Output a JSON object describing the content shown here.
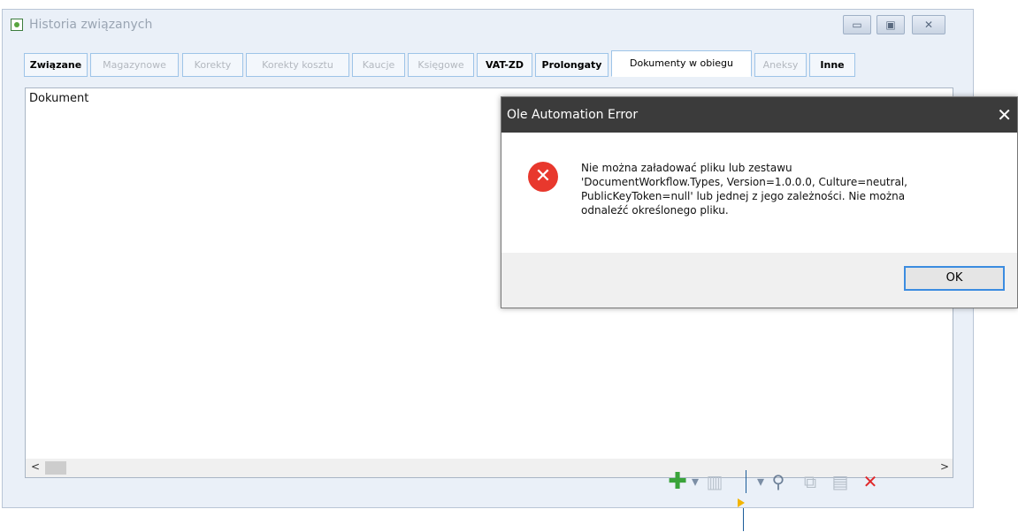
{
  "window": {
    "title": "Historia związanych",
    "controls": {
      "minimize": "▭",
      "maximize": "▣",
      "close": "✕"
    }
  },
  "tabs": [
    {
      "label": "Związane",
      "enabled": true
    },
    {
      "label": "Magazynowe",
      "enabled": false
    },
    {
      "label": "Korekty",
      "enabled": false
    },
    {
      "label": "Korekty kosztu",
      "enabled": false
    },
    {
      "label": "Kaucje",
      "enabled": false
    },
    {
      "label": "Księgowe",
      "enabled": false
    },
    {
      "label": "VAT-ZD",
      "enabled": true
    },
    {
      "label": "Prolongaty",
      "enabled": true
    },
    {
      "label": "Dokumenty w obiegu",
      "enabled": true,
      "active": true
    },
    {
      "label": "Aneksy",
      "enabled": false
    },
    {
      "label": "Inne",
      "enabled": true
    }
  ],
  "list": {
    "column_header": "Dokument"
  },
  "scrollbar": {
    "left_arrow": "<",
    "right_arrow": ">"
  },
  "toolbar": {
    "icons": [
      "add-icon",
      "dropdown-icon",
      "delete-icon",
      "open-document-icon",
      "dropdown-icon",
      "search-icon",
      "link-icon",
      "details-icon",
      "close-red-icon"
    ]
  },
  "dialog": {
    "title": "Ole Automation Error",
    "close_glyph": "✕",
    "icon": "error-icon",
    "message_lines": [
      "Nie można załadować pliku lub zestawu",
      "'DocumentWorkflow.Types, Version=1.0.0.0, Culture=neutral,",
      "PublicKeyToken=null' lub jednej z jego zależności. Nie można",
      "odnaleźć określonego pliku."
    ],
    "ok_label": "OK"
  }
}
